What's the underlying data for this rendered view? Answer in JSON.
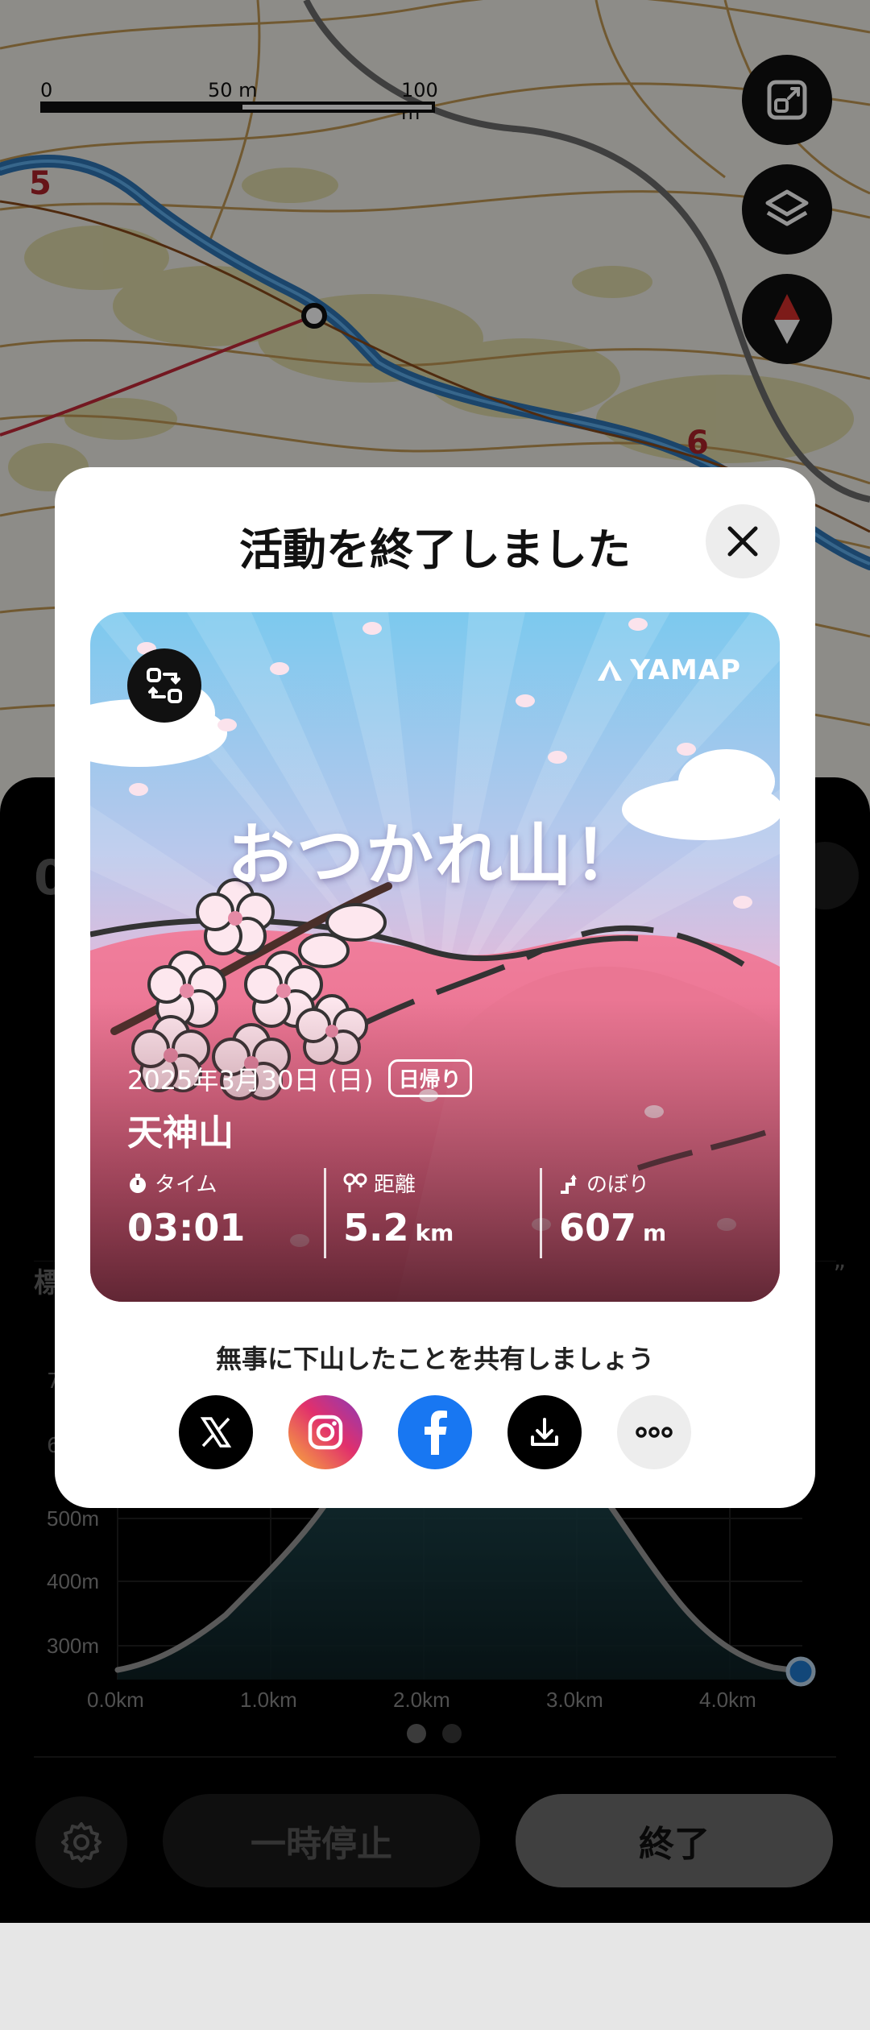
{
  "map": {
    "scale": {
      "zero": "0",
      "mid": "50 m",
      "max": "100 m"
    },
    "route_markers": [
      "5",
      "6"
    ],
    "buttons": [
      "fit-route-icon",
      "layers-icon",
      "compass-icon"
    ]
  },
  "panel": {
    "stub_top": "0",
    "stub_label_left": "標",
    "stub_label_right": "”",
    "stub_y1": "7",
    "stub_y2": "6",
    "elevation": {
      "y_labels": [
        "500m",
        "400m",
        "300m"
      ],
      "x_labels": [
        "0.0km",
        "1.0km",
        "2.0km",
        "3.0km",
        "4.0km"
      ]
    },
    "pause_label": "一時停止",
    "end_label": "終了"
  },
  "modal": {
    "title": "活動を終了しました",
    "card": {
      "brand": "YAMAP",
      "headline": "おつかれ山！",
      "date": "2025年3月30日 (日)",
      "trip_type": "日帰り",
      "mountain": "天神山",
      "stats": [
        {
          "label": "タイム",
          "value": "03:01",
          "unit": ""
        },
        {
          "label": "距離",
          "value": "5.2",
          "unit": "km"
        },
        {
          "label": "のぼり",
          "value": "607",
          "unit": "m"
        }
      ]
    },
    "share_prompt": "無事に下山したことを共有しましょう",
    "share_buttons": [
      "x-icon",
      "instagram-icon",
      "facebook-icon",
      "download-icon",
      "more-icon"
    ]
  },
  "colors": {
    "accent_blue": "#1f7bd0",
    "facebook_blue": "#1877f2",
    "route_blue": "#2f77b8",
    "marker_red": "#b0232a"
  }
}
